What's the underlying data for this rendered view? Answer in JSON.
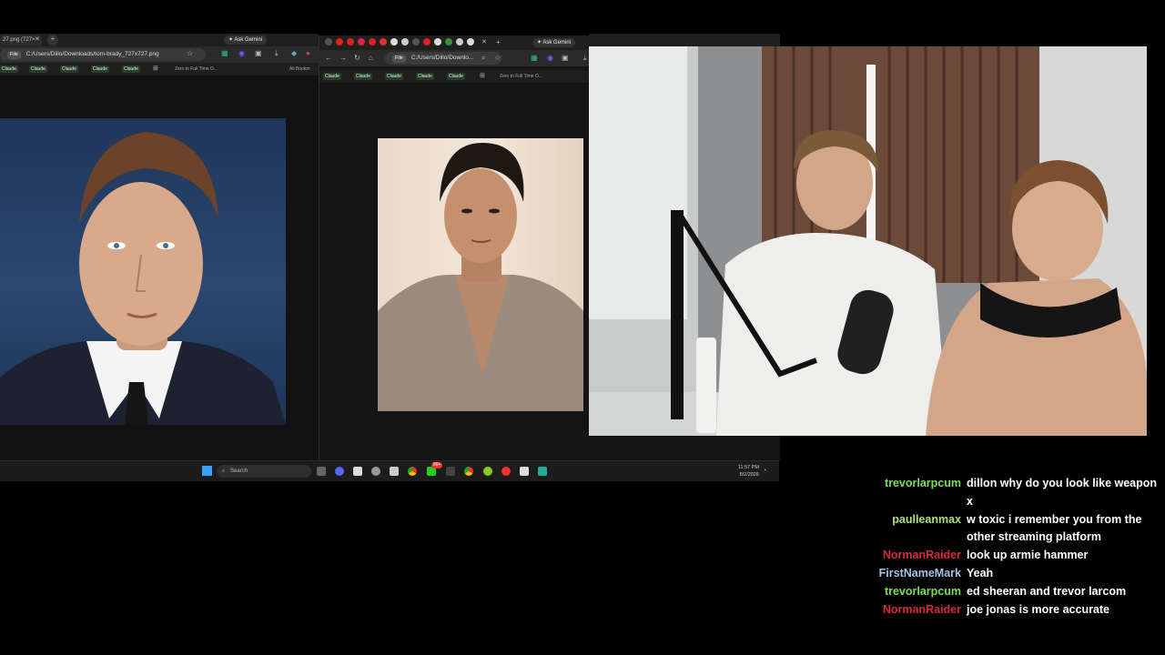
{
  "browser_left": {
    "tab_title": "27.png (727×",
    "ask_gemini": "Ask Gemini",
    "file_label": "File",
    "url": "C:/Users/Dillo/Downloads/tom-brady_727x727.png",
    "bookmarks": [
      "Claude",
      "Claude",
      "Claude",
      "Claude",
      "Claude"
    ],
    "bookmark_extra": "Zero to Full Time O...",
    "all_bookmarks": "All Bookm"
  },
  "browser_right": {
    "ask_gemini": "Ask Gemini",
    "file_label": "File",
    "url": "C:/Users/Dillo/Downlo...",
    "bookmarks": [
      "Claude",
      "Claude",
      "Claude",
      "Claude",
      "Claude"
    ],
    "bookmark_extra": "Zero to Full Time O..."
  },
  "taskbar": {
    "search_placeholder": "Search",
    "time": "11:57 PM",
    "date": "8/2/2026",
    "badge": "99+"
  },
  "chat": {
    "messages": [
      {
        "user": "trevorlarpcum",
        "color": "#7ddc5a",
        "text": "dillon why do you look like weapon x"
      },
      {
        "user": "paulleanmax",
        "color": "#a8e07a",
        "text": "w toxic i remember you from the other streaming platform"
      },
      {
        "user": "NormanRaider",
        "color": "#d62a3a",
        "text": "look up armie hammer"
      },
      {
        "user": "FirstNameMark",
        "color": "#a7c2e6",
        "text": "Yeah"
      },
      {
        "user": "trevorlarpcum",
        "color": "#7ddc5a",
        "text": "ed sheeran and trevor larcom"
      },
      {
        "user": "NormanRaider",
        "color": "#d62a3a",
        "text": "joe jonas is more accurate"
      }
    ]
  },
  "colors": {
    "accent_green": "#7ddc5a",
    "accent_red": "#d62a3a",
    "accent_blue": "#a7c2e6"
  }
}
